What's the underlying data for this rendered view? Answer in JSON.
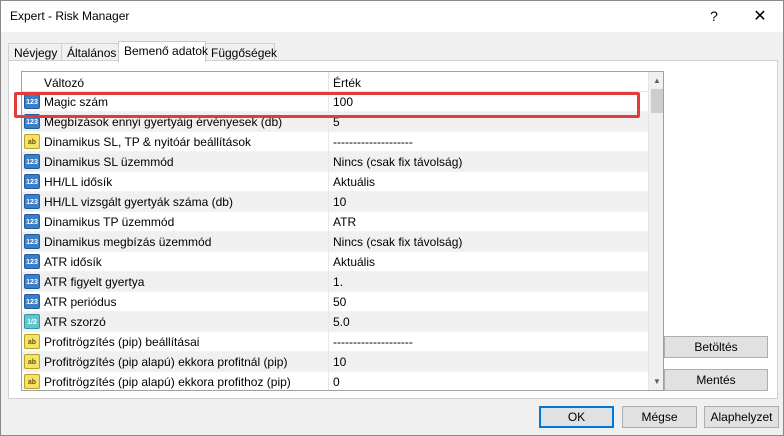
{
  "window": {
    "title": "Expert - Risk Manager",
    "help": "?",
    "close": "✕"
  },
  "tabs": [
    {
      "label": "Névjegy"
    },
    {
      "label": "Általános"
    },
    {
      "label": "Bemenő adatok"
    },
    {
      "label": "Függőségek"
    }
  ],
  "grid": {
    "col_name": "Változó",
    "col_value": "Érték",
    "rows": [
      {
        "icon": "123",
        "name": "Magic szám",
        "value": "100"
      },
      {
        "icon": "123",
        "name": "Megbízások ennyi gyertyáig érvényesek (db)",
        "value": "5"
      },
      {
        "icon": "ab",
        "name": "Dinamikus SL, TP & nyitóár beállítások",
        "value": "--------------------"
      },
      {
        "icon": "123",
        "name": "Dinamikus SL üzemmód",
        "value": "Nincs (csak fix távolság)"
      },
      {
        "icon": "123",
        "name": "HH/LL idősík",
        "value": "Aktuális"
      },
      {
        "icon": "123",
        "name": "HH/LL vizsgált gyertyák száma (db)",
        "value": "10"
      },
      {
        "icon": "123",
        "name": "Dinamikus TP üzemmód",
        "value": "ATR"
      },
      {
        "icon": "123",
        "name": "Dinamikus megbízás üzemmód",
        "value": "Nincs (csak fix távolság)"
      },
      {
        "icon": "123",
        "name": "ATR idősík",
        "value": "Aktuális"
      },
      {
        "icon": "123",
        "name": "ATR figyelt gyertya",
        "value": "1."
      },
      {
        "icon": "123",
        "name": "ATR periódus",
        "value": "50"
      },
      {
        "icon": "1/2",
        "name": "ATR szorzó",
        "value": "5.0"
      },
      {
        "icon": "ab",
        "name": "Profitrögzítés (pip) beállításai",
        "value": "--------------------"
      },
      {
        "icon": "ab",
        "name": "Profitrögzítés (pip alapú) ekkora profitnál (pip)",
        "value": "10"
      },
      {
        "icon": "ab",
        "name": "Profitrögzítés (pip alapú) ekkora profithoz (pip)",
        "value": "0"
      }
    ]
  },
  "buttons": {
    "load": "Betöltés",
    "save": "Mentés",
    "ok": "OK",
    "cancel": "Mégse",
    "reset": "Alaphelyzet"
  },
  "colors": {
    "highlight": "#e33b3b",
    "default_button_border": "#0078d7"
  }
}
